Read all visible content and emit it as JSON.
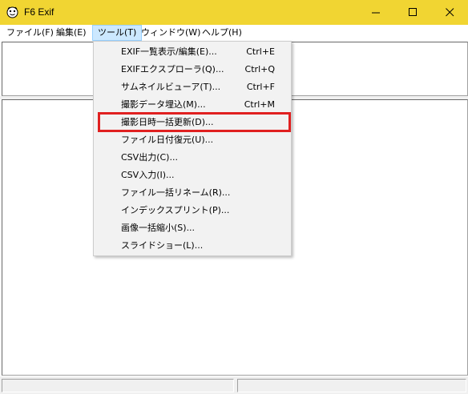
{
  "window": {
    "title": "F6 Exif",
    "title_bar_color": "#f1d532",
    "app_icon": "f6exif-app-icon",
    "controls": [
      "minimize-icon",
      "maximize-icon",
      "close-icon"
    ]
  },
  "menubar": {
    "items": [
      {
        "label": "ファイル(F)"
      },
      {
        "label": "編集(E)"
      },
      {
        "label": "ツール(T)",
        "active": true
      },
      {
        "label": "ウィンドウ(W)"
      },
      {
        "label": "ヘルプ(H)"
      }
    ]
  },
  "tools_menu": {
    "items": [
      {
        "label": "EXIF一覧表示/編集(E)...",
        "shortcut": "Ctrl+E"
      },
      {
        "label": "EXIFエクスプローラ(Q)...",
        "shortcut": "Ctrl+Q"
      },
      {
        "label": "サムネイルビューア(T)...",
        "shortcut": "Ctrl+F"
      },
      {
        "label": "撮影データ埋込(M)...",
        "shortcut": "Ctrl+M"
      },
      {
        "label": "撮影日時一括更新(D)...",
        "shortcut": "",
        "highlighted": true
      },
      {
        "label": "ファイル日付復元(U)...",
        "shortcut": ""
      },
      {
        "label": "CSV出力(C)...",
        "shortcut": ""
      },
      {
        "label": "CSV入力(I)...",
        "shortcut": ""
      },
      {
        "label": "ファイル一括リネーム(R)...",
        "shortcut": ""
      },
      {
        "label": "インデックスプリント(P)...",
        "shortcut": ""
      },
      {
        "label": "画像一括縮小(S)...",
        "shortcut": ""
      },
      {
        "label": "スライドショー(L)...",
        "shortcut": ""
      }
    ]
  },
  "annotation": {
    "color": "#e02020"
  },
  "colors": {
    "menu_active_bg": "#cce8ff",
    "menu_bg": "#f2f2f2"
  }
}
